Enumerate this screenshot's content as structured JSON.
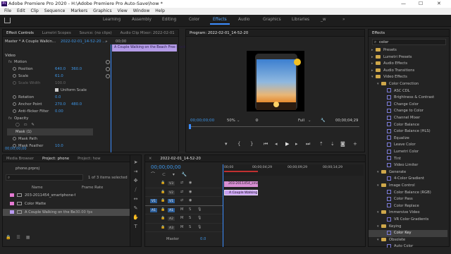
{
  "window": {
    "title": "Adobe Premiere Pro 2020 - H:\\Adobe Premiere Pro Auto-Save\\how *",
    "logo_text": "Pr",
    "minimize": "—",
    "maximize": "☐",
    "close": "✕"
  },
  "menu": [
    "File",
    "Edit",
    "Clip",
    "Sequence",
    "Markers",
    "Graphics",
    "View",
    "Window",
    "Help"
  ],
  "workspaces": [
    {
      "label": "Learning",
      "active": false
    },
    {
      "label": "Assembly",
      "active": false
    },
    {
      "label": "Editing",
      "active": false
    },
    {
      "label": "Color",
      "active": false
    },
    {
      "label": "Effects",
      "active": true
    },
    {
      "label": "Audio",
      "active": false
    },
    {
      "label": "Graphics",
      "active": false
    },
    {
      "label": "Libraries",
      "active": false
    },
    {
      "label": "_w",
      "active": false
    }
  ],
  "source_panel": {
    "tabs": [
      "Effect Controls",
      "Lumetri Scopes",
      "Source: (no clips)",
      "Audio Clip Mixer: 2022-02-01"
    ],
    "master_label": "Master * A Couple Walkin...",
    "sequence_label": "2022-02-01_14-52-20 ...",
    "timecode_label": "00;00",
    "clip_bar_label": "A Couple Walking on the Beach  Free Stock F",
    "section_video": "Video",
    "motion": "Motion",
    "position_label": "Position",
    "position_x": "640.0",
    "position_y": "360.0",
    "scale_label": "Scale",
    "scale_value": "61.0",
    "scale_width_label": "Scale Width",
    "uniform_scale_label": "Uniform Scale",
    "rotation_label": "Rotation",
    "rotation_value": "0.0",
    "anchor_label": "Anchor Point",
    "anchor_x": "270.0",
    "anchor_y": "480.0",
    "antiflicker_label": "Anti-flicker Filter",
    "antiflicker_value": "0.00",
    "opacity_label": "Opacity",
    "mask_label": "Mask (1)",
    "mask_path_label": "Mask Path",
    "mask_feather_label": "Mask Feather",
    "mask_feather_value": "10.0",
    "bottom_timecode": "00;00;00;00"
  },
  "program": {
    "title": "Program: 2022-02-01_14-52-20",
    "timecode_in": "00;00;00;00",
    "zoom": "50%",
    "resolution": "Full",
    "timecode_out": "00;00;04;29"
  },
  "effects_panel": {
    "title": "Effects",
    "search_value": "color",
    "items": [
      {
        "label": "Presets",
        "indent": 0,
        "kind": "folder",
        "expanded": false
      },
      {
        "label": "Lumetri Presets",
        "indent": 0,
        "kind": "folder",
        "expanded": false
      },
      {
        "label": "Audio Effects",
        "indent": 0,
        "kind": "folder",
        "expanded": false
      },
      {
        "label": "Audio Transitions",
        "indent": 0,
        "kind": "folder",
        "expanded": false
      },
      {
        "label": "Video Effects",
        "indent": 0,
        "kind": "folder",
        "expanded": true
      },
      {
        "label": "Color Correction",
        "indent": 1,
        "kind": "folder",
        "expanded": true
      },
      {
        "label": "ASC CDL",
        "indent": 2,
        "kind": "effect",
        "expanded": false
      },
      {
        "label": "Brightness & Contrast",
        "indent": 2,
        "kind": "effect",
        "expanded": false
      },
      {
        "label": "Change Color",
        "indent": 2,
        "kind": "effect",
        "expanded": false
      },
      {
        "label": "Change to Color",
        "indent": 2,
        "kind": "effect",
        "expanded": false
      },
      {
        "label": "Channel Mixer",
        "indent": 2,
        "kind": "effect",
        "expanded": false
      },
      {
        "label": "Color Balance",
        "indent": 2,
        "kind": "effect",
        "expanded": false
      },
      {
        "label": "Color Balance (HLS)",
        "indent": 2,
        "kind": "effect",
        "expanded": false
      },
      {
        "label": "Equalize",
        "indent": 2,
        "kind": "effect",
        "expanded": false
      },
      {
        "label": "Leave Color",
        "indent": 2,
        "kind": "effect",
        "expanded": false
      },
      {
        "label": "Lumetri Color",
        "indent": 2,
        "kind": "effect",
        "expanded": false
      },
      {
        "label": "Tint",
        "indent": 2,
        "kind": "effect",
        "expanded": false
      },
      {
        "label": "Video Limiter",
        "indent": 2,
        "kind": "effect",
        "expanded": false
      },
      {
        "label": "Generate",
        "indent": 1,
        "kind": "folder",
        "expanded": true
      },
      {
        "label": "4-Color Gradient",
        "indent": 2,
        "kind": "effect",
        "expanded": false
      },
      {
        "label": "Image Control",
        "indent": 1,
        "kind": "folder",
        "expanded": true
      },
      {
        "label": "Color Balance (RGB)",
        "indent": 2,
        "kind": "effect",
        "expanded": false
      },
      {
        "label": "Color Pass",
        "indent": 2,
        "kind": "effect",
        "expanded": false
      },
      {
        "label": "Color Replace",
        "indent": 2,
        "kind": "effect",
        "expanded": false
      },
      {
        "label": "Immersive Video",
        "indent": 1,
        "kind": "folder",
        "expanded": true
      },
      {
        "label": "VR Color Gradients",
        "indent": 2,
        "kind": "effect",
        "expanded": false
      },
      {
        "label": "Keying",
        "indent": 1,
        "kind": "folder",
        "expanded": true
      },
      {
        "label": "Color Key",
        "indent": 2,
        "kind": "effect",
        "expanded": false,
        "selected": true
      },
      {
        "label": "Obsolete",
        "indent": 1,
        "kind": "folder",
        "expanded": true
      },
      {
        "label": "Auto Color",
        "indent": 2,
        "kind": "effect",
        "expanded": false
      }
    ]
  },
  "project_panel": {
    "tabs": [
      "Media Browser",
      "Project: phone",
      "Project: how"
    ],
    "file": "phone.prproj",
    "selection_count": "1 of 3 items selected",
    "col_name": "Name",
    "col_rate": "Frame Rate",
    "items": [
      {
        "name": "203-2011454_smartphone-f",
        "rate": "",
        "color": "#e47ad3",
        "selected": false
      },
      {
        "name": "Color Matte",
        "rate": "",
        "color": "#e47ad3",
        "selected": false
      },
      {
        "name": "A Couple Walking on the Be",
        "rate": "30.00 fps",
        "color": "#b99af0",
        "selected": true
      }
    ]
  },
  "timeline": {
    "sequence_name": "2022-02-01_14-52-20",
    "timecode": "00;00;00;00",
    "ruler": [
      "00;00",
      "00;00;04;29",
      "00;00;09;29",
      "00;00;14;29"
    ],
    "tracks": [
      {
        "id": "V3",
        "src": "",
        "kind": "video"
      },
      {
        "id": "V2",
        "src": "",
        "kind": "video"
      },
      {
        "id": "V1",
        "src": "V1",
        "kind": "video"
      },
      {
        "id": "A1",
        "src": "A1",
        "kind": "audio"
      },
      {
        "id": "A2",
        "src": "",
        "kind": "audio"
      },
      {
        "id": "A3",
        "src": "",
        "kind": "audio"
      }
    ],
    "master_label": "Master",
    "master_value": "0.0",
    "clip_v2": "203-2011454_sma",
    "clip_v1": "A Couple Walking"
  },
  "colors": {
    "accent": "#3c8dff",
    "timecode_blue": "#3d96e8",
    "clip_pink": "#dd8ed5",
    "clip_violet": "#c9a0f0"
  },
  "icons": [
    "home-icon",
    "search-icon",
    "play-icon",
    "wrench-icon",
    "camera-icon",
    "selection-tool-icon",
    "razor-icon",
    "hand-icon",
    "type-icon",
    "pen-icon"
  ]
}
